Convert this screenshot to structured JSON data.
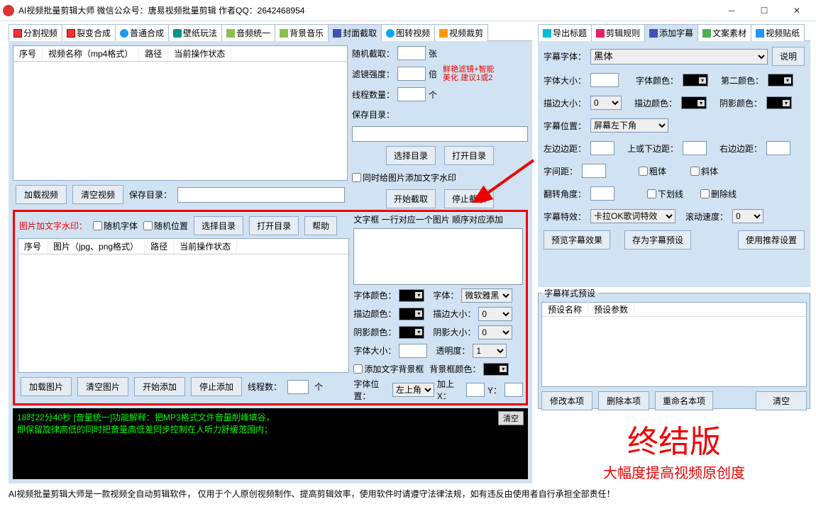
{
  "title": "AI视频批量剪辑大师   微信公众号：唐易视频批量剪辑    作者QQ：2642468954",
  "tabs_left": [
    {
      "label": "分割视频",
      "icon": "ic-red"
    },
    {
      "label": "裂变合成",
      "icon": "ic-red"
    },
    {
      "label": "普通合成",
      "icon": "ic-blue"
    },
    {
      "label": "壁纸玩法",
      "icon": "ic-teal"
    },
    {
      "label": "音频统一",
      "icon": "ic-note"
    },
    {
      "label": "背景音乐",
      "icon": "ic-note"
    },
    {
      "label": "封面截取",
      "icon": "ic-pic",
      "active": true
    },
    {
      "label": "图转视频",
      "icon": "ic-circ"
    },
    {
      "label": "视频裁剪",
      "icon": "ic-cut"
    }
  ],
  "tabs_right": [
    {
      "label": "导出标题",
      "icon": "ic-export"
    },
    {
      "label": "剪辑规则",
      "icon": "ic-rule"
    },
    {
      "label": "添加字幕",
      "icon": "ic-sub",
      "active": true
    },
    {
      "label": "文案素材",
      "icon": "ic-txt"
    },
    {
      "label": "视频贴纸",
      "icon": "ic-stk"
    }
  ],
  "videotbl": {
    "cols": [
      "序号",
      "视频名称（mp4格式）",
      "路径",
      "当前操作状态"
    ]
  },
  "cover": {
    "rand_capture": "随机截取：",
    "unit_sheet": "张",
    "filter": "滤镜强度：",
    "unit_times": "倍",
    "tip1": "鲜艳滤镜+智能",
    "tip2": "美化 建议1或2",
    "threads": "线程数量：",
    "unit_ge": "个",
    "savedir": "保存目录：",
    "btn_sel": "选择目录",
    "btn_open": "打开目录",
    "chk_add_wm": "同时给图片添加文字水印",
    "btn_start": "开始截取",
    "btn_stop": "停止截取"
  },
  "btns1": {
    "load": "加载视频",
    "clear": "清空视频",
    "savedir": "保存目录："
  },
  "wm": {
    "title": "图片加文字水印：",
    "rand_font": "随机字体",
    "rand_pos": "随机位置",
    "sel": "选择目录",
    "open": "打开目录",
    "help": "帮助",
    "cols": [
      "序号",
      "图片（jpg、png格式）",
      "路径",
      "当前操作状态"
    ],
    "load": "加载图片",
    "clear": "清空图片",
    "start": "开始添加",
    "stop": "停止添加",
    "threads": "线程数：",
    "unit": "个",
    "txtbox_title": "文字框 一行对应一个图片 顺序对应添加",
    "font_color": "字体颜色：",
    "font": "字体：",
    "font_val": "微软雅黑",
    "stroke_color": "描边颜色：",
    "stroke_size": "描边大小：",
    "stroke_val": "0",
    "shadow_color": "阴影颜色：",
    "shadow_size": "阴影大小：",
    "shadow_val": "0",
    "font_size": "字体大小：",
    "opacity": "透明度：",
    "opacity_val": "1",
    "add_bg": "添加文字背景框",
    "bg_color": "背景框颜色：",
    "pos": "字体位置：",
    "pos_val": "左上角",
    "addx": "加上X：",
    "y": "Y："
  },
  "log": {
    "line1": "18时22分40秒 [音量统一]功能解释：把MP3格式文件音量削峰填谷，",
    "line2": "    即保留旋律高低的同时把音量高低差同步控制在人听力舒缓范围内；",
    "clear": "清空"
  },
  "sub": {
    "explain": "说明",
    "font": "字幕字体：",
    "font_val": "黑体",
    "size": "字体大小：",
    "color": "字体颜色：",
    "color2": "第二颜色：",
    "stroke": "描边大小：",
    "stroke_val": "0",
    "stroke_color": "描边颜色：",
    "shadow_color": "阴影颜色：",
    "pos": "字幕位置：",
    "pos_val": "屏幕左下角",
    "ml": "左边边距：",
    "mt": "上或下边距：",
    "mr": "右边边距：",
    "spacing": "字间距：",
    "bold": "粗体",
    "italic": "斜体",
    "rotate": "翻转角度：",
    "underline": "下划线",
    "strike": "删除线",
    "fx": "字幕特效：",
    "fx_val": "卡拉OK歌词特效",
    "speed": "滚动速度：",
    "speed_val": "0",
    "preview": "预览字幕效果",
    "save": "存为字幕预设",
    "recommend": "使用推荐设置",
    "preset_title": "字幕样式预设",
    "preset_cols": [
      "预设名称",
      "预设参数"
    ],
    "edit": "修改本项",
    "del": "删除本项",
    "rename": "重命名本项",
    "clear": "清空"
  },
  "promo": {
    "t1": "终结版",
    "t2": "大幅度提高视频原创度"
  },
  "footer": "AI视频批量剪辑大师是一款视频全自动剪辑软件，  仅用于个人原创视频制作、提高剪辑效率，使用软件时请遵守法律法规，如有违反由使用者自行承担全部责任！"
}
